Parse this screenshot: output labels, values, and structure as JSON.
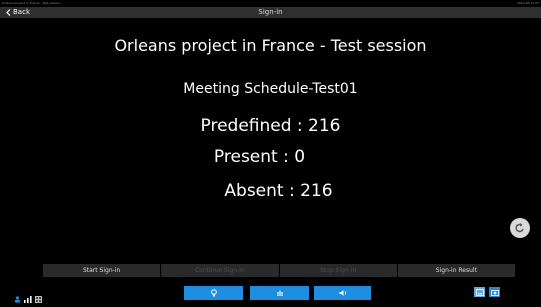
{
  "status": {
    "left_text": "Orleans project in France - Test session",
    "right_text": "2023-08 11:27"
  },
  "header": {
    "back_label": "Back",
    "title": "Sign-in"
  },
  "main": {
    "session_title": "Orleans project in France - Test session",
    "meeting_name": "Meeting Schedule-Test01",
    "predefined": "Predefined : 216",
    "present": "Present : 0",
    "absent": "Absent : 216"
  },
  "actions": [
    {
      "label": "Start Sign-in",
      "enabled": true
    },
    {
      "label": "Continue Sign-in",
      "enabled": false
    },
    {
      "label": "Stop Sign-in",
      "enabled": false
    },
    {
      "label": "Sign-in Result",
      "enabled": true
    }
  ],
  "navbar": {
    "left_icons": [
      "person-icon",
      "signal-bars-icon",
      "grid-icon"
    ],
    "center_buttons": [
      "bulb-icon",
      "hand-icon",
      "volume-icon"
    ],
    "right_icons": [
      "keyboard-icon",
      "camera-icon"
    ],
    "accent": "#1e8fe0"
  }
}
